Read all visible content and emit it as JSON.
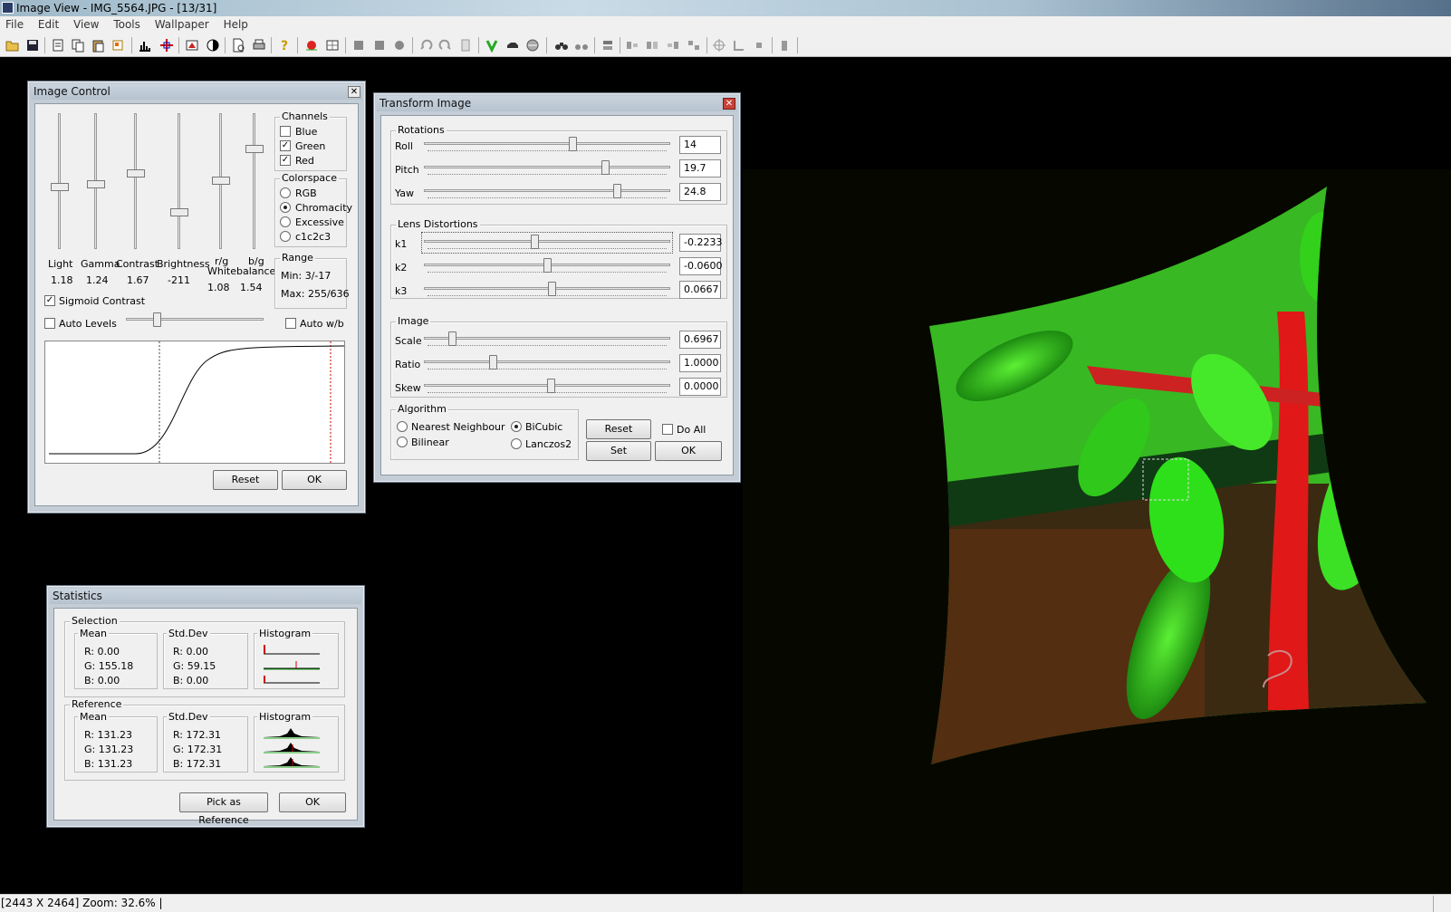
{
  "window": {
    "title": "Image View - IMG_5564.JPG - [13/31]",
    "menu": [
      "File",
      "Edit",
      "View",
      "Tools",
      "Wallpaper",
      "Help"
    ]
  },
  "toolbar": {
    "icons": [
      "open-icon",
      "save-icon",
      "scan-icon",
      "copy-icon",
      "paste-icon",
      "crop-icon",
      "histogram-icon",
      "crosshair-icon",
      "transform-icon",
      "contrast-icon",
      "page-icon",
      "print-icon",
      "help-icon",
      "red-eye-icon",
      "grid-icon",
      "square-icon",
      "square-icon",
      "circle-icon",
      "rotate-left-icon",
      "rotate-right-icon",
      "doc-icon",
      "green-icon",
      "car-icon",
      "disc-icon",
      "binoculars-icon",
      "binoculars-2-icon",
      "stack-icon",
      "align-left-icon",
      "align-center-icon",
      "align-right-icon",
      "align-justify-icon",
      "target-icon",
      "angle-icon",
      "stop-icon",
      "trash-icon"
    ]
  },
  "image_control": {
    "title": "Image Control",
    "sliders": [
      {
        "label": "Light",
        "value": "1.18",
        "level": 0.55
      },
      {
        "label": "Gamma",
        "value": "1.24",
        "level": 0.53
      },
      {
        "label": "Contrast",
        "value": "1.67",
        "level": 0.44
      },
      {
        "label": "Brightness",
        "value": "-211",
        "level": 0.75
      },
      {
        "label": "r/g",
        "value": "1.08",
        "level": 0.5
      },
      {
        "label": "b/g",
        "value": "1.54",
        "level": 0.25
      }
    ],
    "whitebalance_label": "Whitebalance",
    "channels": {
      "label": "Channels",
      "items": [
        {
          "label": "Blue",
          "checked": false
        },
        {
          "label": "Green",
          "checked": true
        },
        {
          "label": "Red",
          "checked": true
        }
      ]
    },
    "colorspace": {
      "label": "Colorspace",
      "items": [
        {
          "label": "RGB",
          "selected": false
        },
        {
          "label": "Chromacity",
          "selected": true
        },
        {
          "label": "Excessive",
          "selected": false
        },
        {
          "label": "c1c2c3",
          "selected": false
        }
      ]
    },
    "range": {
      "label": "Range",
      "min": "Min: 3/-17",
      "max": "Max: 255/636"
    },
    "sigmoid_contrast": {
      "label": "Sigmoid Contrast",
      "checked": true
    },
    "auto_levels": {
      "label": "Auto Levels",
      "checked": false
    },
    "auto_wb": {
      "label": "Auto w/b",
      "checked": false
    },
    "reset_label": "Reset",
    "ok_label": "OK"
  },
  "transform_image": {
    "title": "Transform Image",
    "rotations": {
      "label": "Rotations",
      "rows": [
        {
          "label": "Roll",
          "value": "14",
          "level": 0.6
        },
        {
          "label": "Pitch",
          "value": "19.7",
          "level": 0.72
        },
        {
          "label": "Yaw",
          "value": "24.8",
          "level": 0.77
        }
      ]
    },
    "lens": {
      "label": "Lens Distortions",
      "rows": [
        {
          "label": "k1",
          "value": "-0.2233",
          "level": 0.44
        },
        {
          "label": "k2",
          "value": "-0.0600",
          "level": 0.5
        },
        {
          "label": "k3",
          "value": "0.0667",
          "level": 0.52
        }
      ]
    },
    "image": {
      "label": "Image",
      "rows": [
        {
          "label": "Scale",
          "value": "0.6967",
          "level": 0.1
        },
        {
          "label": "Ratio",
          "value": "1.0000",
          "level": 0.27
        },
        {
          "label": "Skew",
          "value": "0.0000",
          "level": 0.52
        }
      ]
    },
    "algorithm": {
      "label": "Algorithm",
      "items": [
        {
          "label": "Nearest Neighbour",
          "selected": false
        },
        {
          "label": "BiCubic",
          "selected": true
        },
        {
          "label": "Bilinear",
          "selected": false
        },
        {
          "label": "Lanczos2",
          "selected": false
        }
      ]
    },
    "reset_label": "Reset",
    "do_all": {
      "label": "Do All",
      "checked": false
    },
    "set_label": "Set",
    "ok_label": "OK"
  },
  "statistics": {
    "title": "Statistics",
    "selection": {
      "label": "Selection",
      "mean": {
        "label": "Mean",
        "r": "R: 0.00",
        "g": "G: 155.18",
        "b": "B: 0.00"
      },
      "stddev": {
        "label": "Std.Dev",
        "r": "R: 0.00",
        "g": "G: 59.15",
        "b": "B: 0.00"
      },
      "histogram": "Histogram"
    },
    "reference": {
      "label": "Reference",
      "mean": {
        "label": "Mean",
        "r": "R: 131.23",
        "g": "G: 131.23",
        "b": "B: 131.23"
      },
      "stddev": {
        "label": "Std.Dev",
        "r": "R: 172.31",
        "g": "G: 172.31",
        "b": "B: 172.31"
      },
      "histogram": "Histogram"
    },
    "pick_reference_label": "Pick as Reference",
    "ok_label": "OK"
  },
  "status": {
    "text": "[2443 X 2464] Zoom: 32.6% |"
  },
  "colors": {
    "leaf_green": "#22cc11",
    "stem_red": "#e01818",
    "dialog_frame": "#c4cdd6"
  }
}
